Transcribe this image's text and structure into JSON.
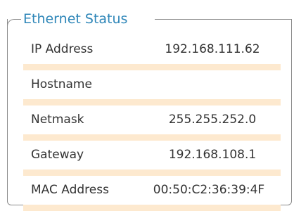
{
  "panel": {
    "title": "Ethernet Status",
    "colors": {
      "title": "#2e86b8",
      "border": "#8c8c8c",
      "row_separator": "#fde9cf",
      "text": "#333333"
    },
    "rows": [
      {
        "label": "IP Address",
        "value": "192.168.111.62"
      },
      {
        "label": "Hostname",
        "value": ""
      },
      {
        "label": "Netmask",
        "value": "255.255.252.0"
      },
      {
        "label": "Gateway",
        "value": "192.168.108.1"
      },
      {
        "label": "MAC Address",
        "value": "00:50:C2:36:39:4F"
      }
    ]
  }
}
